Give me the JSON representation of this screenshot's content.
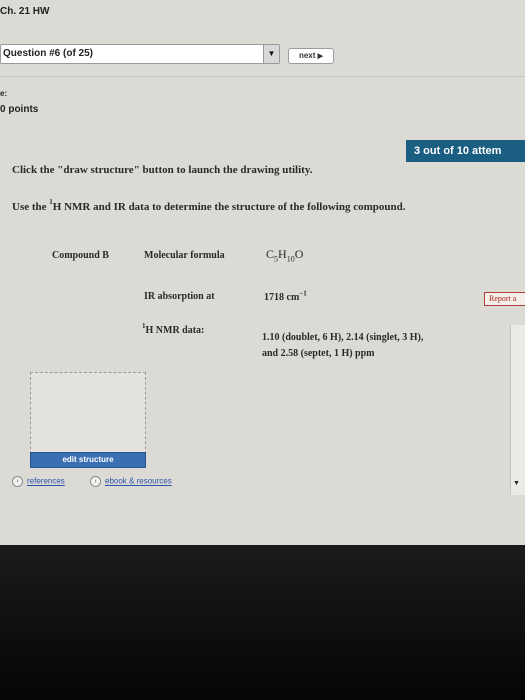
{
  "header": {
    "title": "Ch. 21 HW"
  },
  "question_nav": {
    "selected": "Question #6 (of 25)",
    "dropdown_arrow": "▼",
    "next_label": "next",
    "next_icon": "▶"
  },
  "sidebar": {
    "label": "e:",
    "points": "0 points"
  },
  "attempts": "3 out of 10 attem",
  "instructions": {
    "line1": "Click the \"draw structure\" button to launch the drawing utility.",
    "line2_pre": "Use the ",
    "line2_sup": "1",
    "line2_post": "H NMR and IR data to determine the structure of the following compound."
  },
  "compound": {
    "name": "Compound B",
    "formula_label": "Molecular formula",
    "formula": {
      "C": "C",
      "c_sub": "5",
      "H": "H",
      "h_sub": "10",
      "O": "O"
    },
    "ir_label": "IR absorption at",
    "ir_value": "1718 cm",
    "ir_sup": "−1",
    "nmr_label_sup": "1",
    "nmr_label": "H NMR data:",
    "nmr_line1": "1.10 (doublet, 6 H), 2.14 (singlet, 3 H),",
    "nmr_line2": "and 2.58 (septet, 1 H) ppm"
  },
  "report_label": "Report a",
  "edit_structure_label": "edit structure",
  "links": {
    "references": "references",
    "ebook": "ebook & resources"
  }
}
